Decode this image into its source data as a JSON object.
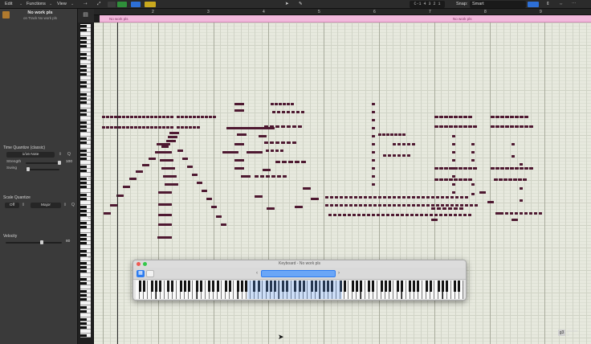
{
  "menubar": {
    "edit": "Edit",
    "functions": "Functions",
    "view": "View",
    "lcd": "C-1  4 3 2 1",
    "snap_label": "Snap:",
    "snap_value": "Smart"
  },
  "inspector": {
    "region_name": "No work pls",
    "region_sub": "on Track No work pls",
    "time_quantize_title": "Time Quantize (classic)",
    "time_quantize_value": "1/16 Note",
    "strength_label": "Strength",
    "strength_value": "100",
    "swing_label": "Swing",
    "scale_quantize_title": "Scale Quantize",
    "scale_off": "Off",
    "scale_mode": "Major",
    "velocity_title": "Velocity",
    "velocity_value": "80"
  },
  "ruler": {
    "bars": [
      "2",
      "3",
      "4",
      "5",
      "6",
      "7",
      "8",
      "9"
    ]
  },
  "region_strip": {
    "label_left": "No work pls",
    "label_right": "No work pls"
  },
  "keyboard_window": {
    "title": "Keyboard - No work pls"
  },
  "vkeys": {
    "octaves": [
      "C6",
      "C5",
      "C4",
      "C3",
      "C2",
      "C1"
    ]
  },
  "watermark": {
    "text": "groove\n3"
  },
  "colors": {
    "note": "#4e1931",
    "region": "#f2b8dc",
    "accent": "#2d7cf0"
  }
}
